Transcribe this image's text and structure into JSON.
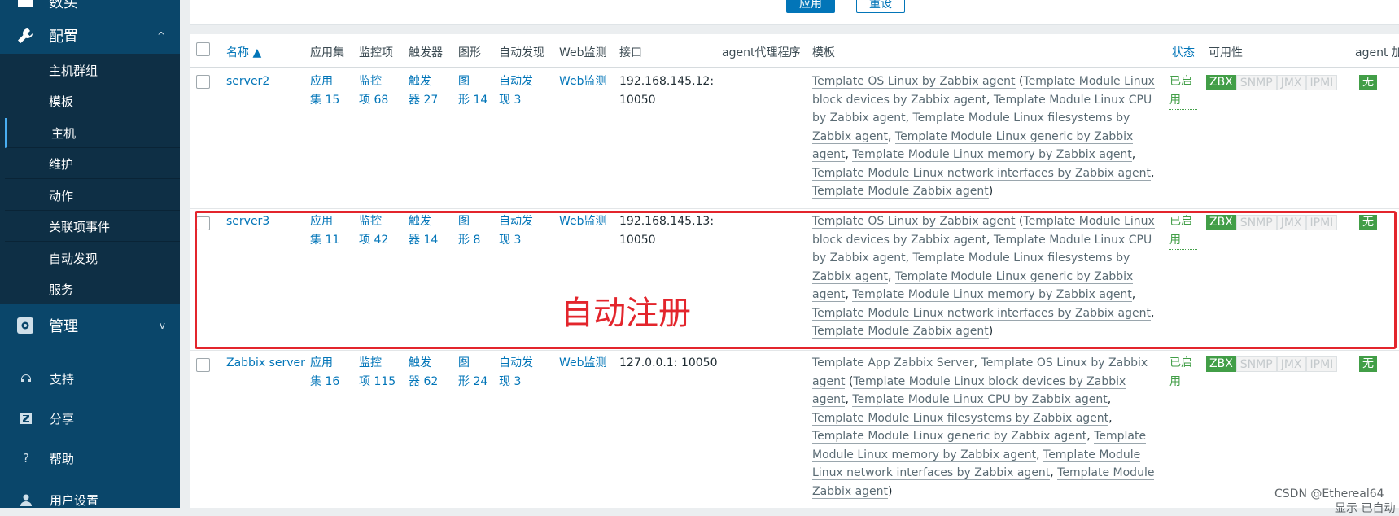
{
  "sidebar": {
    "top_partial_label": "数买",
    "config_label": "配置",
    "config_chevron": "^",
    "sub_items": [
      {
        "label": "主机群组",
        "active": false
      },
      {
        "label": "模板",
        "active": false
      },
      {
        "label": "主机",
        "active": true
      },
      {
        "label": "维护",
        "active": false
      },
      {
        "label": "动作",
        "active": false
      },
      {
        "label": "关联项事件",
        "active": false
      },
      {
        "label": "自动发现",
        "active": false
      },
      {
        "label": "服务",
        "active": false
      }
    ],
    "admin_label": "管理",
    "admin_chevron": "v",
    "footer": [
      {
        "label": "支持",
        "icon": "headset-icon"
      },
      {
        "label": "分享",
        "icon": "share-icon"
      },
      {
        "label": "帮助",
        "icon": "help-icon"
      },
      {
        "label": "用户设置",
        "icon": "user-icon"
      }
    ]
  },
  "filter": {
    "apply_label": "应用",
    "reset_label": "重设"
  },
  "table": {
    "headers": {
      "name": "名称 ▲",
      "apps": "应用集",
      "items": "监控项",
      "triggers": "触发器",
      "graphs": "图形",
      "discovery": "自动发现",
      "web": "Web监测",
      "interface": "接口",
      "proxy": "agent代理程序",
      "templates": "模板",
      "status": "状态",
      "availability": "可用性",
      "encryption": "agent 加"
    },
    "rows": [
      {
        "name": "server2",
        "apps": [
          "应用",
          "集 15"
        ],
        "items": [
          "监控",
          "项 68"
        ],
        "triggers": [
          "触发",
          "器 27"
        ],
        "graphs": [
          "图",
          "形 14"
        ],
        "discovery": [
          "自动发",
          "现 3"
        ],
        "web": "Web监测",
        "interface": [
          "192.168.145.12:",
          "10050"
        ],
        "templates": [
          "Template OS Linux by Zabbix agent",
          " (",
          "Template Module Linux block devices by Zabbix agent",
          ", ",
          "Template Module Linux CPU by Zabbix agent",
          ", ",
          "Template Module Linux filesystems by Zabbix agent",
          ", ",
          "Template Module Linux generic by Zabbix agent",
          ", ",
          "Template Module Linux memory by Zabbix agent",
          ", ",
          "Template Module Linux network interfaces by Zabbix agent",
          ", ",
          "Template Module Zabbix agent",
          ")"
        ],
        "status": "已启用",
        "avail": [
          "ZBX",
          "SNMP",
          "JMX",
          "IPMI"
        ],
        "encryption": "无"
      },
      {
        "name": "server3",
        "apps": [
          "应用",
          "集 11"
        ],
        "items": [
          "监控",
          "项 42"
        ],
        "triggers": [
          "触发",
          "器 14"
        ],
        "graphs": [
          "图",
          "形 8"
        ],
        "discovery": [
          "自动发",
          "现 3"
        ],
        "web": "Web监测",
        "interface": [
          "192.168.145.13:",
          "10050"
        ],
        "templates": [
          "Template OS Linux by Zabbix agent",
          " (",
          "Template Module Linux block devices by Zabbix agent",
          ", ",
          "Template Module Linux CPU by Zabbix agent",
          ", ",
          "Template Module Linux filesystems by Zabbix agent",
          ", ",
          "Template Module Linux generic by Zabbix agent",
          ", ",
          "Template Module Linux memory by Zabbix agent",
          ", ",
          "Template Module Linux network interfaces by Zabbix agent",
          ", ",
          "Template Module Zabbix agent",
          ")"
        ],
        "status": "已启用",
        "avail": [
          "ZBX",
          "SNMP",
          "JMX",
          "IPMI"
        ],
        "encryption": "无"
      },
      {
        "name": "Zabbix server",
        "apps": [
          "应用",
          "集 16"
        ],
        "items": [
          "监控",
          "项 115"
        ],
        "triggers": [
          "触发",
          "器 62"
        ],
        "graphs": [
          "图",
          "形 24"
        ],
        "discovery": [
          "自动发",
          "现 3"
        ],
        "web": "Web监测",
        "interface": [
          "127.0.0.1: 10050"
        ],
        "templates": [
          "Template App Zabbix Server",
          ", ",
          "Template OS Linux by Zabbix agent",
          " (",
          "Template Module Linux block devices by Zabbix agent",
          ", ",
          "Template Module Linux CPU by Zabbix agent",
          ", ",
          "Template Module Linux filesystems by Zabbix agent",
          ", ",
          "Template Module Linux generic by Zabbix agent",
          ", ",
          "Template Module Linux memory by Zabbix agent",
          ", ",
          "Template Module Linux network interfaces by Zabbix agent",
          ", ",
          "Template Module Zabbix agent",
          ")"
        ],
        "status": "已启用",
        "avail": [
          "ZBX",
          "SNMP",
          "JMX",
          "IPMI"
        ],
        "encryption": "无"
      }
    ]
  },
  "annotation": "自动注册",
  "watermark": "CSDN @Ethereal64",
  "bottom_cut_text": "显示 已自动",
  "colors": {
    "sidebar": "#0a466a",
    "submenu": "#0e2f45",
    "link": "#0275b8",
    "ok": "#429e47",
    "highlight": "#e3252c"
  }
}
